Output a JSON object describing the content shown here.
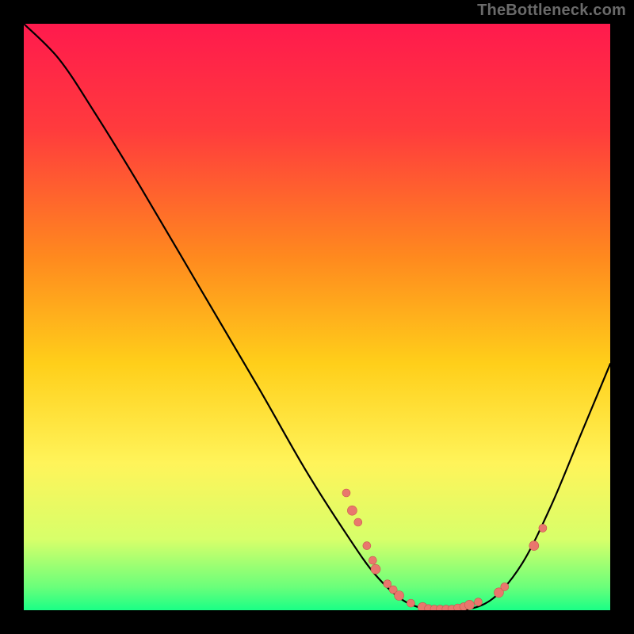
{
  "attribution": "TheBottleneck.com",
  "colors": {
    "point_fill": "#e9776d",
    "point_stroke": "#c9564d",
    "curve": "#000000"
  },
  "chart_data": {
    "type": "line",
    "title": "",
    "xlabel": "",
    "ylabel": "",
    "xlim": [
      0,
      100
    ],
    "ylim": [
      0,
      100
    ],
    "curve": [
      {
        "x": 0,
        "y": 100
      },
      {
        "x": 6,
        "y": 94
      },
      {
        "x": 12,
        "y": 85
      },
      {
        "x": 20,
        "y": 72
      },
      {
        "x": 30,
        "y": 55
      },
      {
        "x": 40,
        "y": 38
      },
      {
        "x": 48,
        "y": 24
      },
      {
        "x": 55,
        "y": 13
      },
      {
        "x": 60,
        "y": 6
      },
      {
        "x": 65,
        "y": 1.5
      },
      {
        "x": 70,
        "y": 0
      },
      {
        "x": 75,
        "y": 0
      },
      {
        "x": 80,
        "y": 2
      },
      {
        "x": 85,
        "y": 8
      },
      {
        "x": 90,
        "y": 18
      },
      {
        "x": 95,
        "y": 30
      },
      {
        "x": 100,
        "y": 42
      }
    ],
    "points": [
      {
        "x": 55,
        "y": 20,
        "r": 5
      },
      {
        "x": 56,
        "y": 17,
        "r": 6
      },
      {
        "x": 57,
        "y": 15,
        "r": 5
      },
      {
        "x": 58.5,
        "y": 11,
        "r": 5
      },
      {
        "x": 59.5,
        "y": 8.5,
        "r": 5
      },
      {
        "x": 60,
        "y": 7,
        "r": 6
      },
      {
        "x": 62,
        "y": 4.5,
        "r": 5
      },
      {
        "x": 63,
        "y": 3.5,
        "r": 5
      },
      {
        "x": 64,
        "y": 2.5,
        "r": 6
      },
      {
        "x": 66,
        "y": 1.2,
        "r": 5
      },
      {
        "x": 68,
        "y": 0.5,
        "r": 6
      },
      {
        "x": 69,
        "y": 0.3,
        "r": 5
      },
      {
        "x": 70,
        "y": 0.2,
        "r": 5
      },
      {
        "x": 71,
        "y": 0.2,
        "r": 5
      },
      {
        "x": 72,
        "y": 0.2,
        "r": 5
      },
      {
        "x": 73,
        "y": 0.2,
        "r": 5
      },
      {
        "x": 74,
        "y": 0.4,
        "r": 5
      },
      {
        "x": 75,
        "y": 0.6,
        "r": 5
      },
      {
        "x": 76,
        "y": 0.9,
        "r": 6
      },
      {
        "x": 77.5,
        "y": 1.4,
        "r": 5
      },
      {
        "x": 81,
        "y": 3,
        "r": 6
      },
      {
        "x": 82,
        "y": 4,
        "r": 5
      },
      {
        "x": 87,
        "y": 11,
        "r": 6
      },
      {
        "x": 88.5,
        "y": 14,
        "r": 5
      }
    ]
  }
}
